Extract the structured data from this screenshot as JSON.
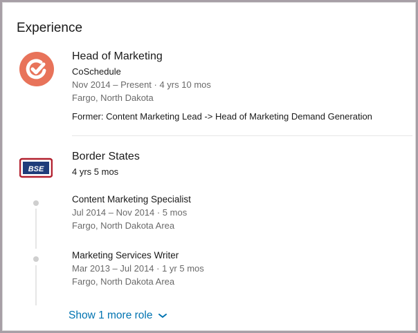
{
  "section": {
    "title": "Experience"
  },
  "positions": [
    {
      "title": "Head of Marketing",
      "company": "CoSchedule",
      "dates": "Nov 2014 – Present · 4 yrs 10 mos",
      "location": "Fargo, North Dakota",
      "description": "Former: Content Marketing Lead -> Head of Marketing Demand Generation",
      "logo_icon": "coschedule-logo-icon",
      "logo_color": "#e8735a"
    }
  ],
  "company_group": {
    "name": "Border States",
    "duration": "4 yrs 5 mos",
    "logo_icon": "border-states-logo-icon",
    "logo_text": "BSE",
    "logo_color": "#1f3d7a",
    "roles": [
      {
        "title": "Content Marketing Specialist",
        "dates": "Jul 2014 – Nov 2014 · 5 mos",
        "location": "Fargo, North Dakota Area"
      },
      {
        "title": "Marketing Services Writer",
        "dates": "Mar 2013 – Jul 2014 · 1 yr 5 mos",
        "location": "Fargo, North Dakota Area"
      }
    ],
    "show_more_label": "Show 1 more role"
  },
  "colors": {
    "link": "#0073b1",
    "frame": "#a79fa6"
  }
}
